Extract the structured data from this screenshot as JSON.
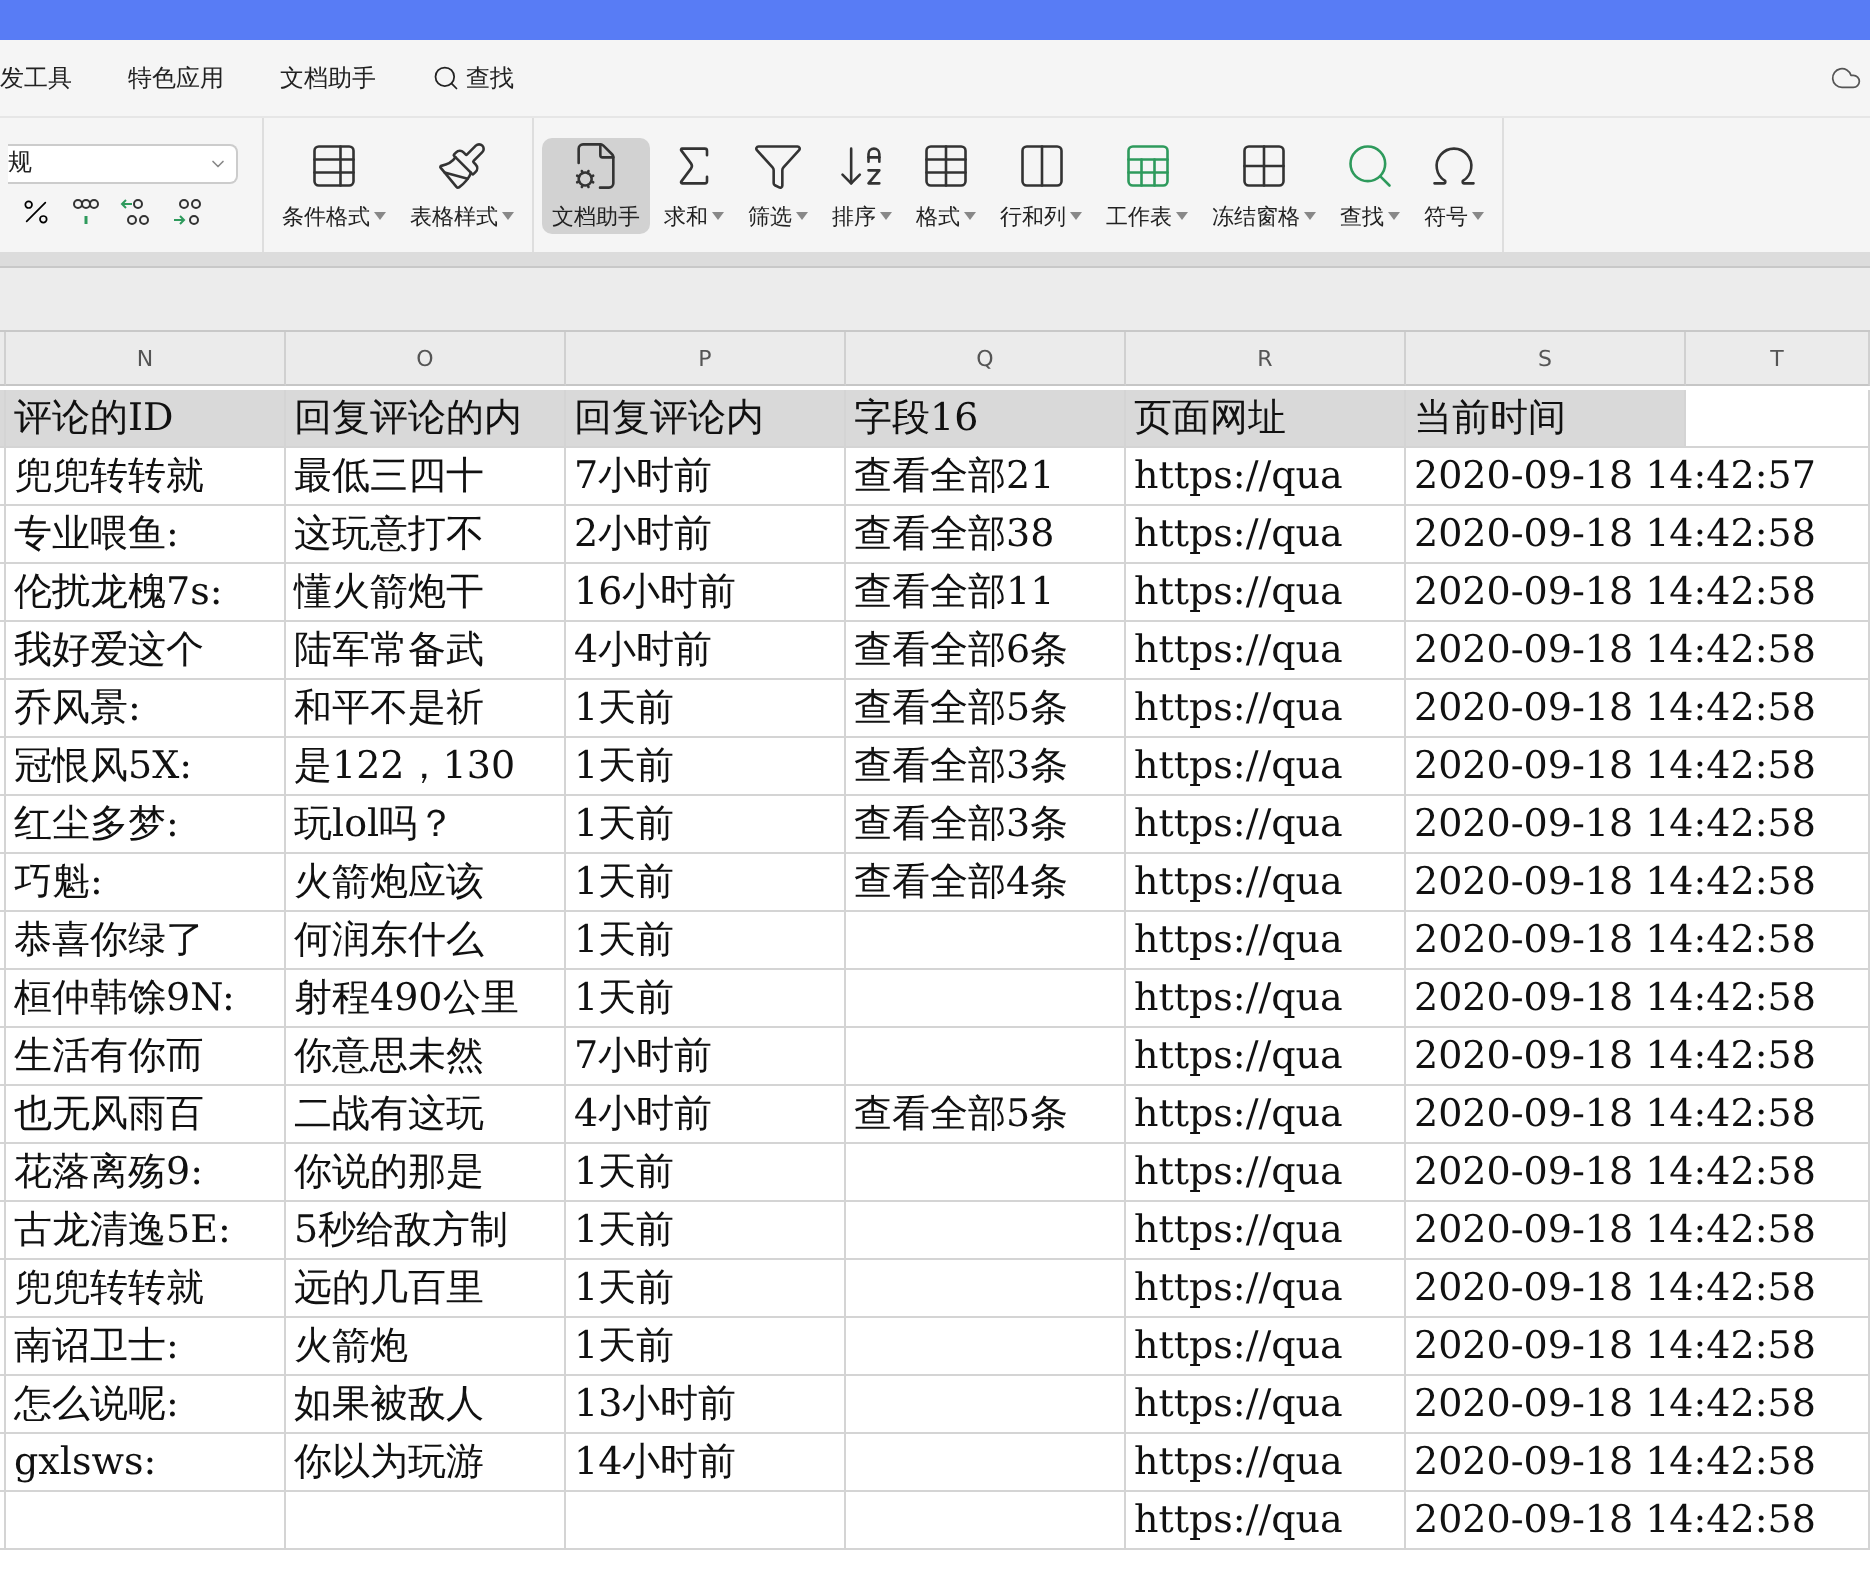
{
  "menu_tabs": [
    {
      "label": "发工具",
      "kind": "text"
    },
    {
      "label": "特色应用",
      "kind": "text"
    },
    {
      "label": "文档助手",
      "kind": "text"
    },
    {
      "label": "查找",
      "kind": "search"
    }
  ],
  "number_format": {
    "value": "规"
  },
  "ribbon": [
    {
      "label": "条件格式",
      "kind": "cond",
      "selected": false
    },
    {
      "label": "表格样式",
      "kind": "style",
      "selected": false
    },
    {
      "label": "文档助手",
      "kind": "doc",
      "selected": true
    },
    {
      "label": "求和",
      "kind": "sum",
      "selected": false
    },
    {
      "label": "筛选",
      "kind": "filter",
      "selected": false
    },
    {
      "label": "排序",
      "kind": "sort",
      "selected": false
    },
    {
      "label": "格式",
      "kind": "format",
      "selected": false
    },
    {
      "label": "行和列",
      "kind": "rowcol",
      "selected": false
    },
    {
      "label": "工作表",
      "kind": "sheet",
      "selected": false
    },
    {
      "label": "冻结窗格",
      "kind": "freeze",
      "selected": false
    },
    {
      "label": "查找",
      "kind": "find",
      "selected": false
    },
    {
      "label": "符号",
      "kind": "symbol",
      "selected": false
    }
  ],
  "sheet": {
    "column_letters": [
      "N",
      "O",
      "P",
      "Q",
      "R",
      "S",
      "T"
    ],
    "header": [
      "评论的ID",
      "回复评论的内",
      "回复评论内",
      "字段16",
      "页面网址",
      "当前时间"
    ],
    "rows": [
      [
        "兜兜转转就",
        "最低三四十",
        "7小时前",
        "查看全部21",
        "https://qua",
        "2020-09-18 14:42:57"
      ],
      [
        "专业喂鱼:",
        "这玩意打不",
        "2小时前",
        "查看全部38",
        "https://qua",
        "2020-09-18 14:42:58"
      ],
      [
        "伦扰龙槐7s:",
        "懂火箭炮干",
        "16小时前",
        "查看全部11",
        "https://qua",
        "2020-09-18 14:42:58"
      ],
      [
        "我好爱这个",
        "陆军常备武",
        "4小时前",
        "查看全部6条",
        "https://qua",
        "2020-09-18 14:42:58"
      ],
      [
        "乔风景:",
        "和平不是祈",
        "1天前",
        "查看全部5条",
        "https://qua",
        "2020-09-18 14:42:58"
      ],
      [
        "冠恨风5X:",
        "是122，130",
        "1天前",
        "查看全部3条",
        "https://qua",
        "2020-09-18 14:42:58"
      ],
      [
        "红尘多梦:",
        "玩lol吗？",
        "1天前",
        "查看全部3条",
        "https://qua",
        "2020-09-18 14:42:58"
      ],
      [
        "巧魁:",
        "火箭炮应该",
        "1天前",
        "查看全部4条",
        "https://qua",
        "2020-09-18 14:42:58"
      ],
      [
        "恭喜你绿了",
        "何润东什么",
        "1天前",
        null,
        "https://qua",
        "2020-09-18 14:42:58"
      ],
      [
        "桓仲韩馀9N:",
        "射程490公里",
        "1天前",
        null,
        "https://qua",
        "2020-09-18 14:42:58"
      ],
      [
        "生活有你而",
        "你意思未然",
        "7小时前",
        null,
        "https://qua",
        "2020-09-18 14:42:58"
      ],
      [
        "也无风雨百",
        "二战有这玩",
        "4小时前",
        "查看全部5条",
        "https://qua",
        "2020-09-18 14:42:58"
      ],
      [
        "花落离殇9:",
        "你说的那是",
        "1天前",
        null,
        "https://qua",
        "2020-09-18 14:42:58"
      ],
      [
        "古龙清逸5E:",
        "5秒给敌方制",
        "1天前",
        null,
        "https://qua",
        "2020-09-18 14:42:58"
      ],
      [
        "兜兜转转就",
        "远的几百里",
        "1天前",
        null,
        "https://qua",
        "2020-09-18 14:42:58"
      ],
      [
        "南诏卫士:",
        "火箭炮",
        "1天前",
        null,
        "https://qua",
        "2020-09-18 14:42:58"
      ],
      [
        "怎么说呢:",
        "如果被敌人",
        "13小时前",
        null,
        "https://qua",
        "2020-09-18 14:42:58"
      ],
      [
        "gxlsws:",
        "你以为玩游",
        "14小时前",
        null,
        "https://qua",
        "2020-09-18 14:42:58"
      ],
      [
        null,
        null,
        null,
        null,
        "https://qua",
        "2020-09-18 14:42:58"
      ]
    ]
  }
}
